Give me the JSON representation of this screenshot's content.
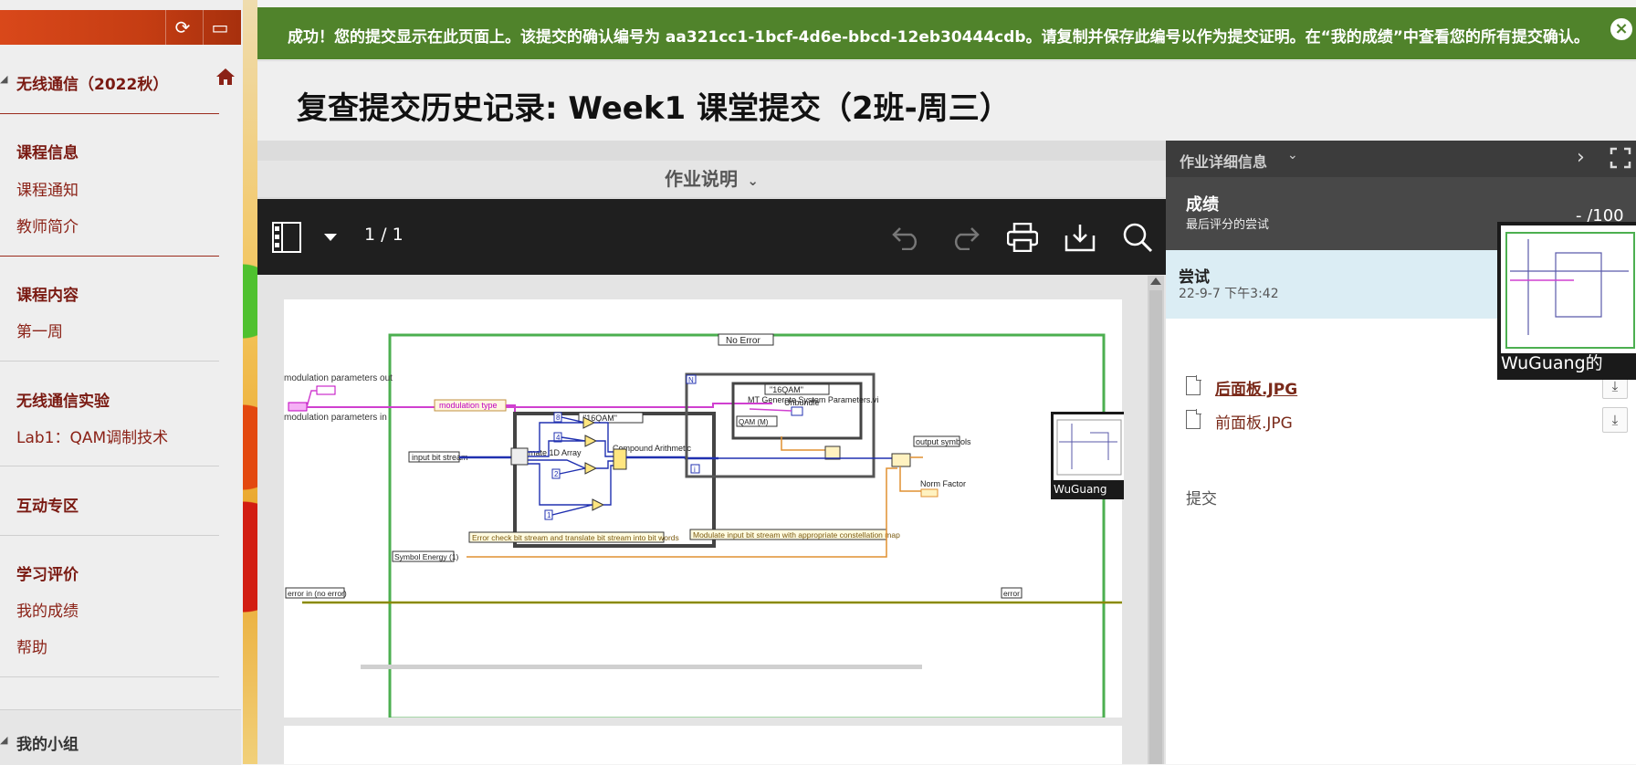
{
  "sidebar": {
    "course_title": "无线通信（2022秋）",
    "sections": [
      {
        "heading": "课程信息",
        "items": [
          "课程通知",
          "教师简介"
        ]
      },
      {
        "heading": "课程内容",
        "items": [
          "第一周"
        ]
      },
      {
        "heading": "无线通信实验",
        "items": [
          "Lab1：QAM调制技术"
        ]
      },
      {
        "heading": "互动专区",
        "items": []
      },
      {
        "heading": "学习评价",
        "items": [
          "我的成绩",
          "帮助"
        ]
      }
    ],
    "my_groups": "我的小组"
  },
  "banner": {
    "message": "成功！您的提交显示在此页面上。该提交的确认编号为 aa321cc1-1bcf-4d6e-bbcd-12eb30444cdb。请复制并保存此编号以作为提交证明。在“我的成绩”中查看您的所有提交确认。",
    "close_icon": "×"
  },
  "page": {
    "title": "复查提交历史记录: Week1 课堂提交（2班-周三）"
  },
  "viewer": {
    "instructions_label": "作业说明",
    "page_indicator": "1 / 1",
    "diagram_text": {
      "no_error": "No Error",
      "mod_params_out": "modulation parameters out",
      "mod_params_in": "modulation parameters in",
      "mod_type": "modulation type",
      "qam16_a": "\"16QAM\"",
      "qam16_b": "\"16QAM\"",
      "input_bit_stream": "input bit stream",
      "decimate": "Decimate 1D Array",
      "compound": "Compound Arithmetic",
      "mt_gen": "MT Generate System Parameters.vi",
      "unbundle": "Unbundle",
      "qam_m": "QAM (M)",
      "output_symbols": "output symbols",
      "norm_factor": "Norm Factor",
      "err_check": "Error check bit stream and translate bit stream into bit words",
      "modulate": "Modulate input bit stream with appropriate constellation map",
      "symbol_energy": "Symbol Energy (1)",
      "error_in": "error in (no error)",
      "error_out": "error",
      "n": "N",
      "i": "i",
      "c8": "8",
      "c4": "4",
      "c2": "2",
      "c1": "1"
    },
    "mini_thumb_caption": "WuGuang"
  },
  "right_panel": {
    "header": "作业详细信息",
    "grade_label": "成绩",
    "grade_sub": "最后评分的尝试",
    "grade_value": "- /100",
    "attempt_label": "尝试",
    "attempt_date": "22-9-7 下午3:42",
    "submission_label": "提交",
    "files": [
      "后面板.JPG",
      "前面板.JPG"
    ],
    "preview_caption": "WuGuang的"
  },
  "colors": {
    "banner_bg": "#50832b",
    "accent_red": "#8b2217",
    "toolbar_bg": "#1f1f1f"
  }
}
